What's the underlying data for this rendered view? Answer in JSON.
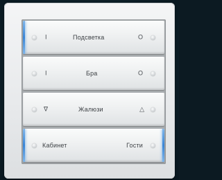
{
  "panel": {
    "keys": [
      {
        "label": "Подсветка",
        "left_symbol": "I",
        "right_symbol": "O"
      },
      {
        "label": "Бра",
        "left_symbol": "I",
        "right_symbol": "O"
      },
      {
        "label": "Жалюзи",
        "left_symbol": "∇",
        "right_symbol": "△"
      },
      {
        "left_label": "Кабинет",
        "right_label": "Гости"
      }
    ],
    "led_color": "#3b86d6",
    "frame_color": "#eceeef"
  }
}
